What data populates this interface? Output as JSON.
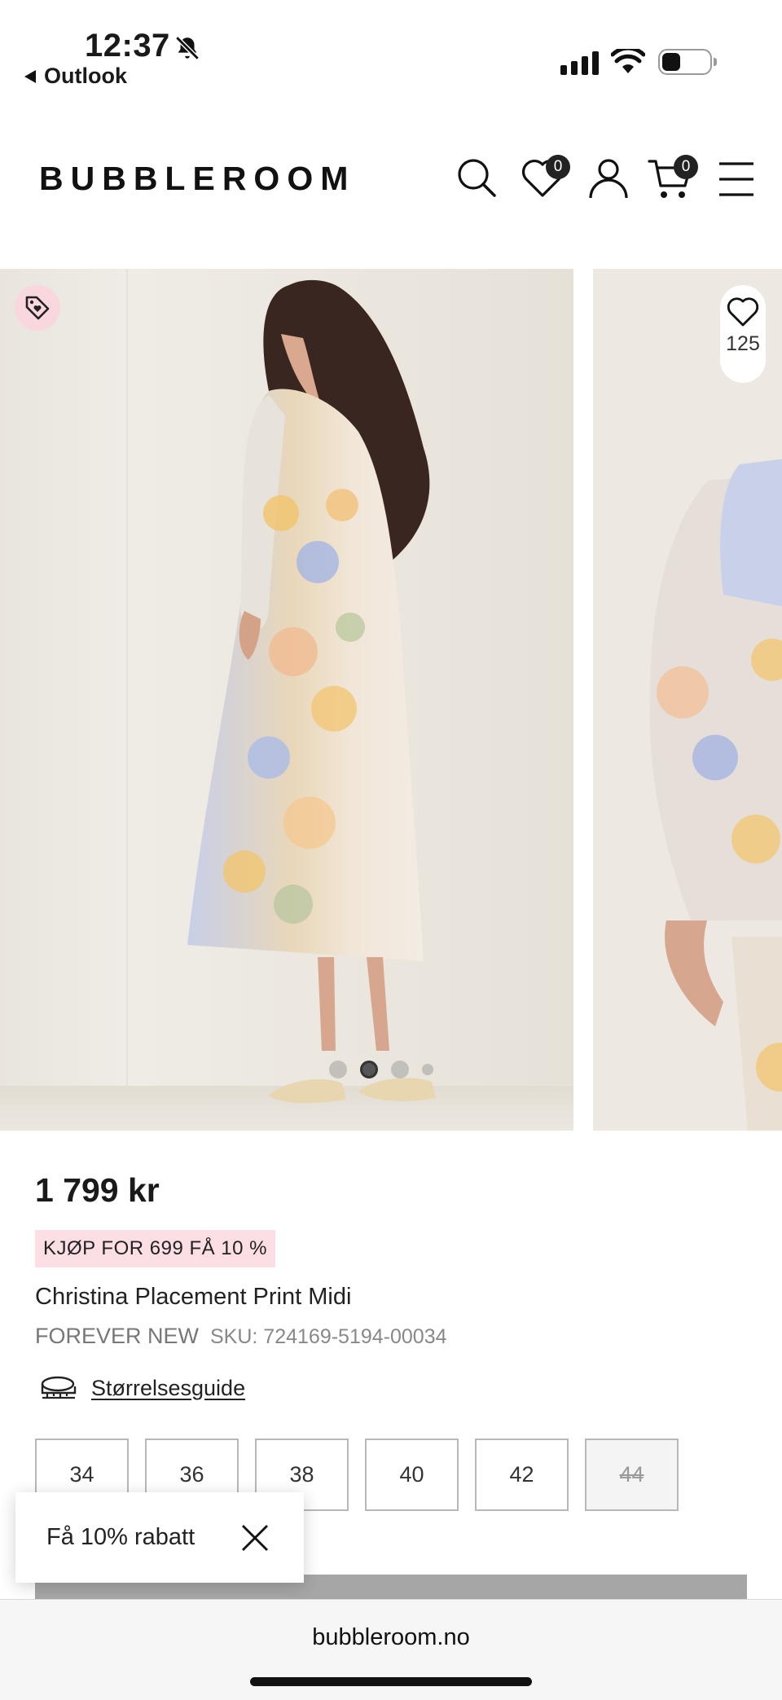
{
  "status_bar": {
    "time": "12:37",
    "back_app": "Outlook"
  },
  "header": {
    "logo": "BUBBLEROOM",
    "wishlist_count": "0",
    "cart_count": "0"
  },
  "gallery": {
    "favorite_count": "125",
    "dot_count": 4,
    "active_dot": 1
  },
  "product": {
    "price": "1 799 kr",
    "promo": "KJØP FOR 699 FÅ 10 %",
    "name": "Christina Placement Print Midi",
    "brand": "FOREVER NEW",
    "sku": "SKU: 724169-5194-00034",
    "size_guide": "Størrelsesguide",
    "sizes": [
      {
        "label": "34",
        "available": true
      },
      {
        "label": "36",
        "available": true
      },
      {
        "label": "38",
        "available": true
      },
      {
        "label": "40",
        "available": true
      },
      {
        "label": "42",
        "available": true
      },
      {
        "label": "44",
        "available": false
      }
    ]
  },
  "discount_popup": {
    "text": "Få 10% rabatt"
  },
  "browser": {
    "url": "bubbleroom.no"
  },
  "colors": {
    "promo_bg": "#fcdfe4",
    "tag_button_bg": "#f8d7df",
    "badge_bg": "#222222"
  }
}
